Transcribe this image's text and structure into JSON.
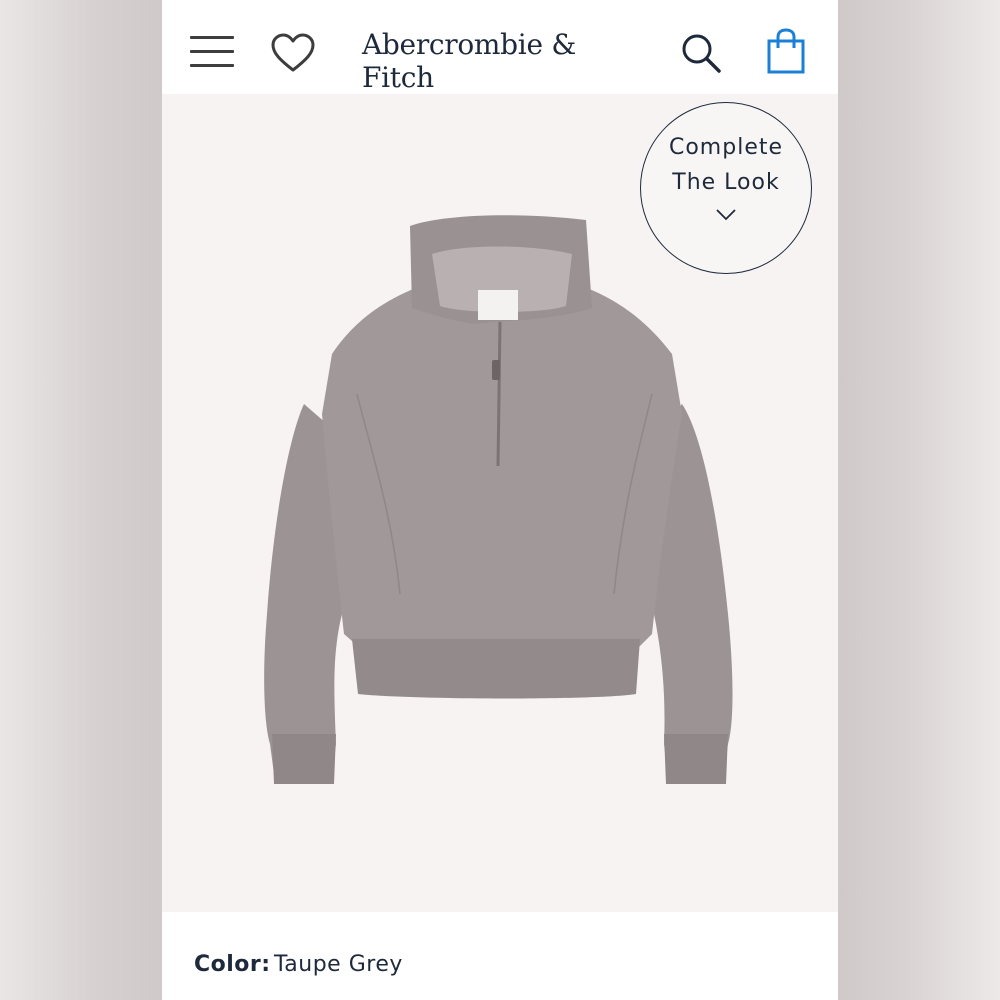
{
  "header": {
    "brand": "Abercrombie & Fitch",
    "menu_icon": "menu-icon",
    "wishlist_icon": "heart-icon",
    "search_icon": "search-icon",
    "bag_icon": "shopping-bag-icon",
    "bag_color": "#1a7fd6"
  },
  "product": {
    "complete_look": {
      "line1": "Complete",
      "line2": "The Look",
      "icon": "chevron-down-icon"
    },
    "color_label": "Color:",
    "color_value": "Taupe Grey",
    "sweater_color": "#9a9192"
  }
}
